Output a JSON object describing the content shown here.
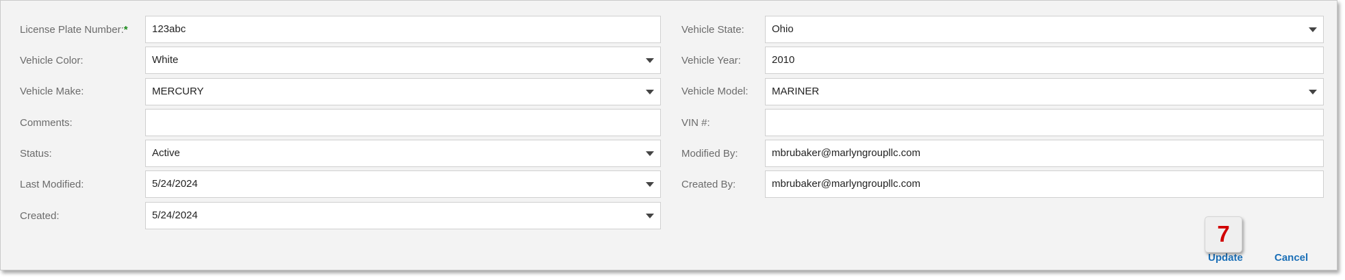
{
  "form": {
    "left": [
      {
        "label": "License Plate Number:",
        "required_mark": "*",
        "value": "123abc"
      },
      {
        "label": "Vehicle Color:",
        "value": "White"
      },
      {
        "label": "Vehicle Make:",
        "value": "MERCURY"
      },
      {
        "label": "Comments:",
        "value": ""
      },
      {
        "label": "Status:",
        "value": "Active"
      },
      {
        "label": "Last Modified:",
        "value": "5/24/2024"
      },
      {
        "label": "Created:",
        "value": "5/24/2024"
      }
    ],
    "right": [
      {
        "label": "Vehicle State:",
        "value": "Ohio"
      },
      {
        "label": "Vehicle Year:",
        "value": "2010"
      },
      {
        "label": "Vehicle Model:",
        "value": "MARINER"
      },
      {
        "label": "VIN #:",
        "value": ""
      },
      {
        "label": "Modified By:",
        "value": "mbrubaker@marlyngroupllc.com"
      },
      {
        "label": "Created By:",
        "value": "mbrubaker@marlyngroupllc.com"
      }
    ]
  },
  "actions": {
    "update_label": "Update",
    "cancel_label": "Cancel"
  },
  "step_badge": "7",
  "colors": {
    "link": "#1a6fb7",
    "required": "#1a8a1a",
    "badge_text": "#d10000"
  }
}
